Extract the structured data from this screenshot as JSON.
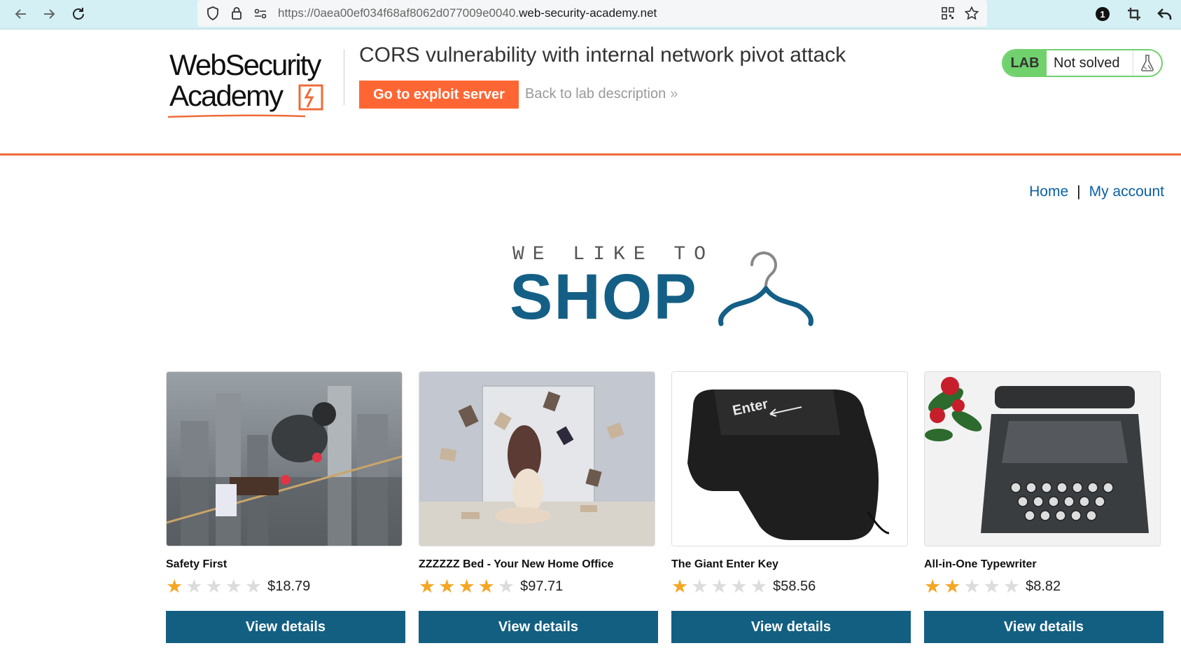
{
  "browser": {
    "url_prefix": "https://0aea00ef034f68af8062d077009e0040.",
    "url_domain": "web-security-academy.net",
    "icons": [
      "back-arrow-icon",
      "forward-arrow-icon",
      "reload-icon",
      "shield-icon",
      "lock-icon",
      "permissions-icon",
      "qr-code-icon",
      "bookmark-star-icon",
      "extension-icon",
      "crop-icon",
      "undo-icon"
    ],
    "extension_badge": "1"
  },
  "lab": {
    "logo_line1": "WebSecurity",
    "logo_line2": "Academy",
    "title": "CORS vulnerability with internal network pivot attack",
    "exploit_button": "Go to exploit server",
    "back_link": "Back to lab description",
    "back_chevron": "»",
    "status_tag": "LAB",
    "status_text": "Not solved",
    "accent_color": "#ff6633",
    "solved_color": "#70d16d"
  },
  "nav": {
    "home": "Home",
    "separator": "|",
    "account": "My account"
  },
  "banner": {
    "small": "WE LIKE TO",
    "big": "SHOP"
  },
  "products": [
    {
      "name": "Safety First",
      "rating": 1,
      "price": "$18.79",
      "button": "View details"
    },
    {
      "name": "ZZZZZZ Bed - Your New Home Office",
      "rating": 4,
      "price": "$97.71",
      "button": "View details"
    },
    {
      "name": "The Giant Enter Key",
      "rating": 1,
      "price": "$58.56",
      "button": "View details"
    },
    {
      "name": "All-in-One Typewriter",
      "rating": 2,
      "price": "$8.82",
      "button": "View details"
    }
  ],
  "product_image_labels": {
    "enter_key": "Enter"
  }
}
